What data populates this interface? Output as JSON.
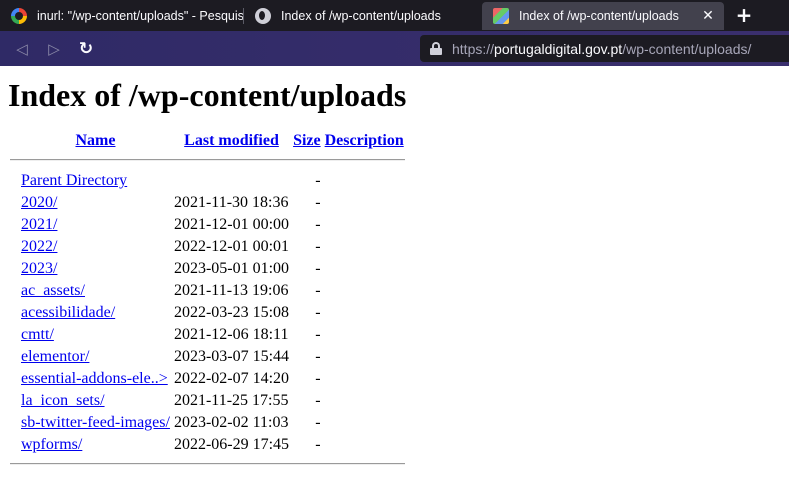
{
  "browser": {
    "tabs": [
      {
        "label": "inurl: \"/wp-content/uploads\" - Pesquisa",
        "icon": "google-icon"
      },
      {
        "label": "Index of /wp-content/uploads",
        "icon": "globe-icon"
      },
      {
        "label": "Index of /wp-content/uploads",
        "icon": "page-icon",
        "active": true
      }
    ],
    "close_tab": "✕",
    "new_tab": "+",
    "url_scheme": "https://",
    "url_host": "portugaldigital.gov.pt",
    "url_path": "/wp-content/uploads/"
  },
  "page": {
    "title": "Index of /wp-content/uploads",
    "columns": {
      "name": "Name",
      "modified": "Last modified",
      "size": "Size",
      "description": "Description"
    },
    "rows": [
      {
        "name": "Parent Directory",
        "modified": "",
        "size": "-"
      },
      {
        "name": "2020/",
        "modified": "2021-11-30 18:36",
        "size": "-"
      },
      {
        "name": "2021/",
        "modified": "2021-12-01 00:00",
        "size": "-"
      },
      {
        "name": "2022/",
        "modified": "2022-12-01 00:01",
        "size": "-"
      },
      {
        "name": "2023/",
        "modified": "2023-05-01 01:00",
        "size": "-"
      },
      {
        "name": "ac_assets/",
        "modified": "2021-11-13 19:06",
        "size": "-"
      },
      {
        "name": "acessibilidade/",
        "modified": "2022-03-23 15:08",
        "size": "-"
      },
      {
        "name": "cmtt/",
        "modified": "2021-12-06 18:11",
        "size": "-"
      },
      {
        "name": "elementor/",
        "modified": "2023-03-07 15:44",
        "size": "-"
      },
      {
        "name": "essential-addons-ele..>",
        "modified": "2022-02-07 14:20",
        "size": "-"
      },
      {
        "name": "la_icon_sets/",
        "modified": "2021-11-25 17:55",
        "size": "-"
      },
      {
        "name": "sb-twitter-feed-images/",
        "modified": "2023-02-02 11:03",
        "size": "-"
      },
      {
        "name": "wpforms/",
        "modified": "2022-06-29 17:45",
        "size": "-"
      }
    ]
  }
}
